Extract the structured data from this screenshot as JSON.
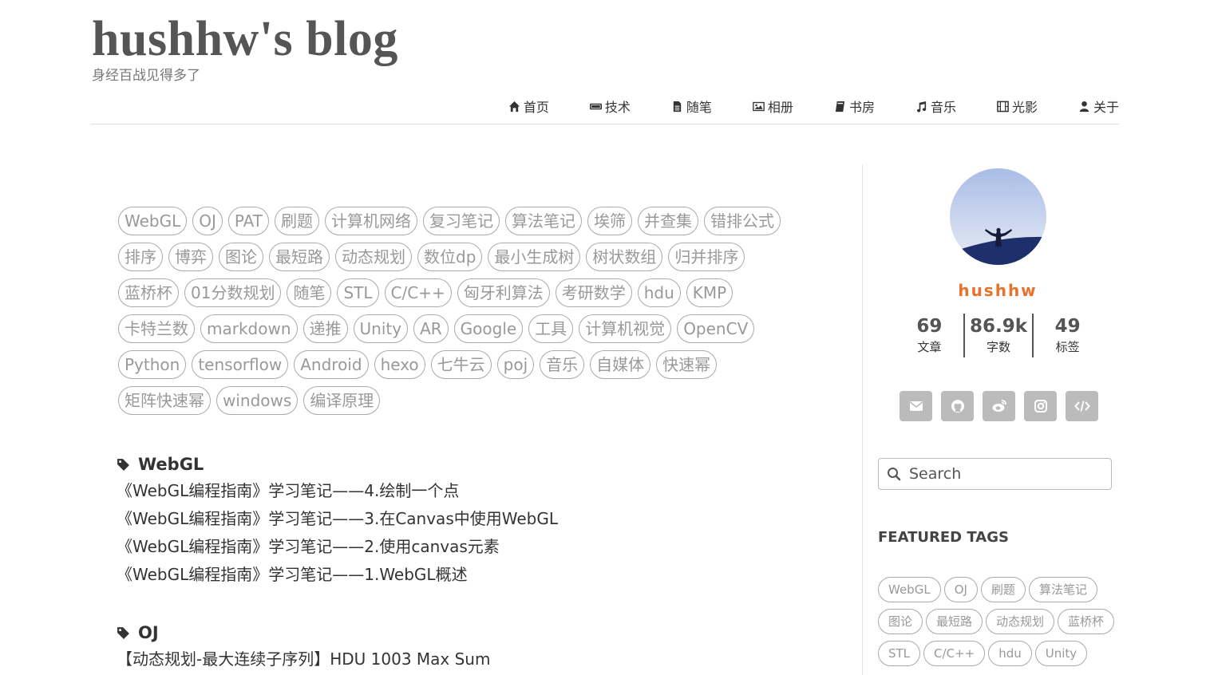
{
  "site": {
    "title": "hushhw's blog",
    "subtitle": "身经百战见得多了"
  },
  "nav": [
    {
      "label": "首页",
      "icon": "home-icon"
    },
    {
      "label": "技术",
      "icon": "keyboard-icon"
    },
    {
      "label": "随笔",
      "icon": "file-icon"
    },
    {
      "label": "相册",
      "icon": "image-icon"
    },
    {
      "label": "书房",
      "icon": "book-icon"
    },
    {
      "label": "音乐",
      "icon": "music-icon"
    },
    {
      "label": "光影",
      "icon": "film-icon"
    },
    {
      "label": "关于",
      "icon": "user-icon"
    }
  ],
  "tag_cloud": [
    "WebGL",
    "OJ",
    "PAT",
    "刷题",
    "计算机网络",
    "复习笔记",
    "算法笔记",
    "埃筛",
    "并查集",
    "错排公式",
    "排序",
    "博弈",
    "图论",
    "最短路",
    "动态规划",
    "数位dp",
    "最小生成树",
    "树状数组",
    "归并排序",
    "蓝桥杯",
    "01分数规划",
    "随笔",
    "STL",
    "C/C++",
    "匈牙利算法",
    "考研数学",
    "hdu",
    "KMP",
    "卡特兰数",
    "markdown",
    "递推",
    "Unity",
    "AR",
    "Google",
    "工具",
    "计算机视觉",
    "OpenCV",
    "Python",
    "tensorflow",
    "Android",
    "hexo",
    "七牛云",
    "poj",
    "音乐",
    "自媒体",
    "快速幂",
    "矩阵快速幂",
    "windows",
    "编译原理"
  ],
  "sections": [
    {
      "tag": "WebGL",
      "posts": [
        "《WebGL编程指南》学习笔记——4.绘制一个点",
        "《WebGL编程指南》学习笔记——3.在Canvas中使用WebGL",
        "《WebGL编程指南》学习笔记——2.使用canvas元素",
        "《WebGL编程指南》学习笔记——1.WebGL概述"
      ]
    },
    {
      "tag": "OJ",
      "posts": [
        "【动态规划-最大连续子序列】HDU 1003 Max Sum"
      ]
    }
  ],
  "sidebar": {
    "author": "hushhw",
    "stats": [
      {
        "num": "69",
        "label": "文章"
      },
      {
        "num": "86.9k",
        "label": "字数"
      },
      {
        "num": "49",
        "label": "标签"
      }
    ],
    "socials": [
      "mail-icon",
      "github-icon",
      "weibo-icon",
      "instagram-icon",
      "code-icon"
    ],
    "search_placeholder": "Search",
    "featured_title": "FEATURED TAGS",
    "featured_tags": [
      "WebGL",
      "OJ",
      "刷题",
      "算法笔记",
      "图论",
      "最短路",
      "动态规划",
      "蓝桥杯",
      "STL",
      "C/C++",
      "hdu",
      "Unity"
    ]
  },
  "colors": {
    "accent": "#e8712b",
    "tag_border": "#aaaaaa",
    "tag_text": "#999999",
    "social_bg": "#bbbbbb"
  }
}
